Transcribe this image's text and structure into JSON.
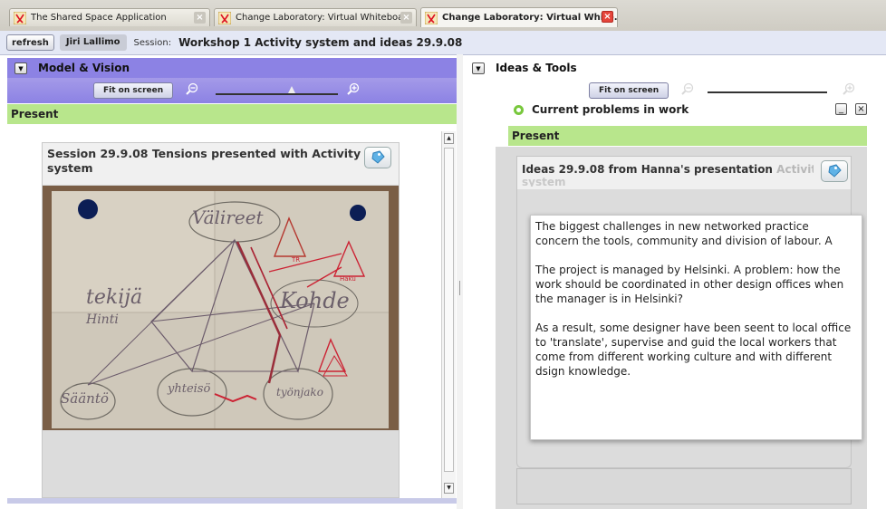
{
  "browser": {
    "tabs": [
      {
        "label": "The Shared Space Application",
        "active": false,
        "favicon": "ribbon-icon"
      },
      {
        "label": "Change Laboratory: Virtual Whiteboard",
        "active": false,
        "favicon": "ribbon-icon"
      },
      {
        "label": "Change Laboratory: Virtual White...",
        "active": true,
        "favicon": "ribbon-icon"
      }
    ]
  },
  "toolbar": {
    "refresh_label": "refresh",
    "user": "Jiri Lallimo",
    "session_label": "Session:",
    "session_title": "Workshop 1 Activity system and  ideas 29.9.08"
  },
  "left_panel": {
    "title": "Model & Vision",
    "fit_label": "Fit on screen",
    "zoom_level": 0.62,
    "section": "Present",
    "card": {
      "title": "Session 29.9.08 Tensions presented with Activity system",
      "photo": "Photo of a flip chart with hand-drawn activity system triangle diagram",
      "photo_annotations": [
        "Välineet",
        "tekijä",
        "Kohde",
        "Sääntö",
        "Yhteisö",
        "Työnjako"
      ]
    }
  },
  "right_panel": {
    "title": "Ideas & Tools",
    "fit_label": "Fit on screen",
    "zoom_level": 0.82,
    "window_title": "Current problems in work",
    "section": "Present",
    "card": {
      "title": "Ideas 29.9.08 from Hanna's presentation",
      "title_overflow": "Activit",
      "title_overflow_line2": "system",
      "note_paragraphs": [
        "The biggest challenges in new networked practice concern the tools, community and division of labour. A",
        "The project is managed by Helsinki. A problem: how the work should be coordinated in other design offices when the manager is in Helsinki?",
        "As a result, some designer have been seent to local office to 'translate', supervise and guid the local workers that come from different working culture and with different dsign knowledge."
      ]
    }
  },
  "colors": {
    "model_header": "#8c82e4",
    "present_bar": "#b8e68c",
    "active_tab_close": "#e5453b"
  }
}
